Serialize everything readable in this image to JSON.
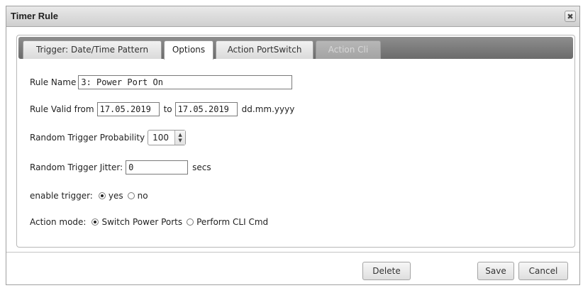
{
  "dialog": {
    "title": "Timer Rule",
    "close_glyph": "✖",
    "close_icon": "close-icon"
  },
  "tabs": [
    {
      "label": "Trigger: Date/Time Pattern",
      "state": "normal"
    },
    {
      "label": "Options",
      "state": "active"
    },
    {
      "label": "Action PortSwitch",
      "state": "normal"
    },
    {
      "label": "Action Cli",
      "state": "disabled"
    }
  ],
  "form": {
    "rule_name_label": "Rule Name",
    "rule_name_value": "3: Power Port On",
    "valid_from_label": "Rule Valid from",
    "valid_from_value": "17.05.2019",
    "valid_to_label": "to",
    "valid_to_value": "17.05.2019",
    "date_format_hint": "dd.mm.yyyy",
    "probability_label": "Random Trigger Probability",
    "probability_value": "100",
    "jitter_label": "Random Trigger Jitter:",
    "jitter_value": "0",
    "jitter_unit": "secs",
    "enable_label": "enable trigger:",
    "enable_yes": "yes",
    "enable_no": "no",
    "enable_selected": "yes",
    "action_mode_label": "Action mode:",
    "action_mode_option1": "Switch Power Ports",
    "action_mode_option2": "Perform CLI Cmd",
    "action_mode_selected": "Switch Power Ports"
  },
  "buttons": {
    "delete": "Delete",
    "save": "Save",
    "cancel": "Cancel"
  },
  "icons": {
    "spinner_up": "▲",
    "spinner_down": "▼"
  }
}
